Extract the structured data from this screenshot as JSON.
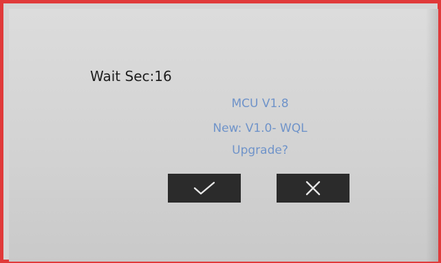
{
  "dialog": {
    "wait_label": "Wait Sec:16",
    "mcu_version": "MCU V1.8",
    "new_version": "New: V1.0- WQL",
    "prompt": "Upgrade?"
  },
  "buttons": {
    "confirm_icon": "check-icon",
    "cancel_icon": "close-icon"
  },
  "colors": {
    "text_accent": "#6f93c9",
    "text_dark": "#1e1e1e",
    "button_bg": "#2b2b2b",
    "button_icon": "#e6e6e6",
    "frame_border": "#e03a3a"
  }
}
